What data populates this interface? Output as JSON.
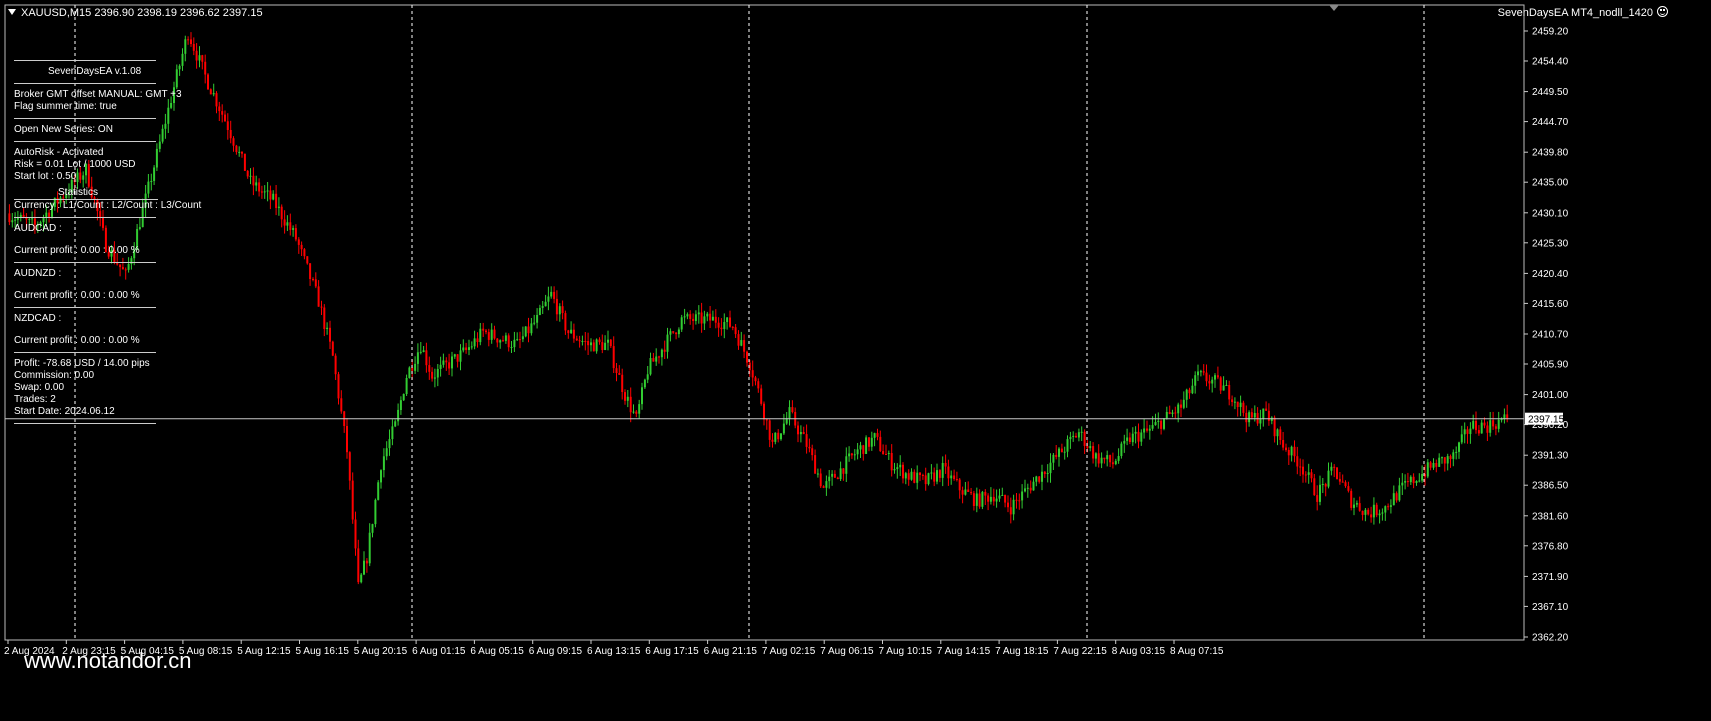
{
  "header": {
    "symbol_info": "XAUUSD,M15  2396.90 2398.19 2396.62 2397.15",
    "ea_name": "SevenDaysEA MT4_nodll_1420"
  },
  "panel": {
    "title": "SevenDaysEA  v.1.08",
    "broker_gmt": "Broker GMT offset MANUAL:  GMT +3",
    "summer_time": "Flag summer time: true",
    "open_new_series": "Open New Series: ON",
    "autorisk": "AutoRisk - Activated",
    "risk": "Risk = 0.01 Lot / 1000 USD",
    "start_lot": "Start lot : 0.50",
    "statistics_title": "Statistics",
    "stats_header": "Currency : L1/Count : L2/Count : L3/Count",
    "pairs": [
      {
        "name": "AUDCAD :",
        "profit": "Current profit : 0.00 : 0.00 %"
      },
      {
        "name": "AUDNZD :",
        "profit": "Current profit : 0.00 : 0.00 %"
      },
      {
        "name": "NZDCAD :",
        "profit": "Current profit : 0.00 : 0.00 %"
      }
    ],
    "profit": "Profit: -78.68 USD / 14.00 pips",
    "commission": "Commission: 0.00",
    "swap": "Swap: 0.00",
    "trades": "Trades: 2",
    "start_date": "Start Date: 2024.06.12"
  },
  "watermark": "www.notandor.cn",
  "colors": {
    "background": "#000000",
    "bull": "#32CD32",
    "bear": "#FF0000",
    "grid": "#FFFFFF",
    "price_line": "#C8C8C8"
  },
  "chart_data": {
    "type": "candlestick",
    "symbol": "XAUUSD",
    "timeframe": "M15",
    "last_price": 2397.15,
    "current_price_label": "2397.15",
    "ylim": [
      2360.4,
      2462.6
    ],
    "y_ticks": [
      "2459.20",
      "2454.40",
      "2449.50",
      "2444.70",
      "2439.80",
      "2435.00",
      "2430.10",
      "2425.30",
      "2420.40",
      "2415.60",
      "2410.70",
      "2405.90",
      "2401.00",
      "2396.20",
      "2391.30",
      "2386.50",
      "2381.60",
      "2376.80",
      "2371.90",
      "2367.10",
      "2362.20"
    ],
    "x_ticks": [
      "2 Aug 2024",
      "2 Aug 23:15",
      "5 Aug 04:15",
      "5 Aug 08:15",
      "5 Aug 12:15",
      "5 Aug 16:15",
      "5 Aug 20:15",
      "6 Aug 01:15",
      "6 Aug 05:15",
      "6 Aug 09:15",
      "6 Aug 13:15",
      "6 Aug 17:15",
      "6 Aug 21:15",
      "7 Aug 02:15",
      "7 Aug 06:15",
      "7 Aug 10:15",
      "7 Aug 14:15",
      "7 Aug 18:15",
      "7 Aug 22:15",
      "8 Aug 03:15",
      "8 Aug 07:15"
    ],
    "anchors": [
      [
        0,
        2430
      ],
      [
        10,
        2428
      ],
      [
        20,
        2433
      ],
      [
        28,
        2437
      ],
      [
        35,
        2425
      ],
      [
        42,
        2420
      ],
      [
        50,
        2434
      ],
      [
        60,
        2452
      ],
      [
        64,
        2459
      ],
      [
        70,
        2452
      ],
      [
        78,
        2444
      ],
      [
        86,
        2435
      ],
      [
        94,
        2432
      ],
      [
        102,
        2426
      ],
      [
        110,
        2416
      ],
      [
        115,
        2407
      ],
      [
        120,
        2392
      ],
      [
        124,
        2370
      ],
      [
        127,
        2375
      ],
      [
        132,
        2390
      ],
      [
        137,
        2396
      ],
      [
        141,
        2404
      ],
      [
        146,
        2409
      ],
      [
        150,
        2404
      ],
      [
        156,
        2406
      ],
      [
        162,
        2408
      ],
      [
        168,
        2411
      ],
      [
        174,
        2410
      ],
      [
        180,
        2409
      ],
      [
        187,
        2413
      ],
      [
        192,
        2417
      ],
      [
        198,
        2411
      ],
      [
        205,
        2409
      ],
      [
        212,
        2409
      ],
      [
        218,
        2401
      ],
      [
        222,
        2397
      ],
      [
        226,
        2405
      ],
      [
        232,
        2409
      ],
      [
        238,
        2413
      ],
      [
        244,
        2413
      ],
      [
        250,
        2413
      ],
      [
        256,
        2412
      ],
      [
        262,
        2406
      ],
      [
        266,
        2400
      ],
      [
        270,
        2393
      ],
      [
        276,
        2398
      ],
      [
        282,
        2393
      ],
      [
        288,
        2386
      ],
      [
        294,
        2389
      ],
      [
        300,
        2392
      ],
      [
        306,
        2394
      ],
      [
        312,
        2390
      ],
      [
        318,
        2388
      ],
      [
        324,
        2387
      ],
      [
        330,
        2389
      ],
      [
        336,
        2386
      ],
      [
        342,
        2384
      ],
      [
        348,
        2385
      ],
      [
        354,
        2383
      ],
      [
        360,
        2386
      ],
      [
        366,
        2389
      ],
      [
        372,
        2392
      ],
      [
        378,
        2395
      ],
      [
        384,
        2391
      ],
      [
        390,
        2390
      ],
      [
        396,
        2394
      ],
      [
        402,
        2395
      ],
      [
        408,
        2397
      ],
      [
        414,
        2399
      ],
      [
        420,
        2404
      ],
      [
        426,
        2403
      ],
      [
        432,
        2401
      ],
      [
        438,
        2397
      ],
      [
        444,
        2398
      ],
      [
        450,
        2393
      ],
      [
        456,
        2390
      ],
      [
        462,
        2385
      ],
      [
        468,
        2389
      ],
      [
        474,
        2384
      ],
      [
        480,
        2382
      ],
      [
        486,
        2383
      ],
      [
        492,
        2386
      ],
      [
        498,
        2388
      ],
      [
        504,
        2390
      ],
      [
        510,
        2391
      ],
      [
        516,
        2396
      ],
      [
        522,
        2396
      ],
      [
        528,
        2397
      ]
    ]
  }
}
